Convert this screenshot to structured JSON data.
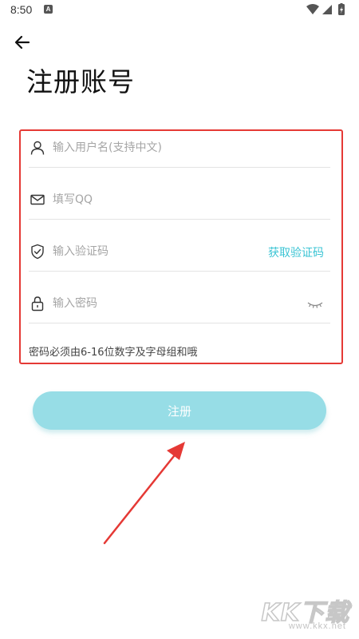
{
  "status_bar": {
    "time": "8:50",
    "notification_letter": "A"
  },
  "page": {
    "title": "注册账号"
  },
  "form": {
    "username": {
      "placeholder": "输入用户名(支持中文)",
      "value": ""
    },
    "qq": {
      "placeholder": "填写QQ",
      "value": ""
    },
    "code": {
      "placeholder": "输入验证码",
      "value": "",
      "action_label": "获取验证码"
    },
    "password": {
      "placeholder": "输入密码",
      "value": ""
    },
    "hint": "密码必须由6-16位数字及字母组和哦"
  },
  "register_button": {
    "label": "注册"
  },
  "watermark": {
    "logo": "KK下载",
    "url": "www.kkx.net"
  },
  "colors": {
    "accent": "#3bc4d4",
    "button_bg": "#97dde6",
    "highlight_border": "#e53935"
  }
}
